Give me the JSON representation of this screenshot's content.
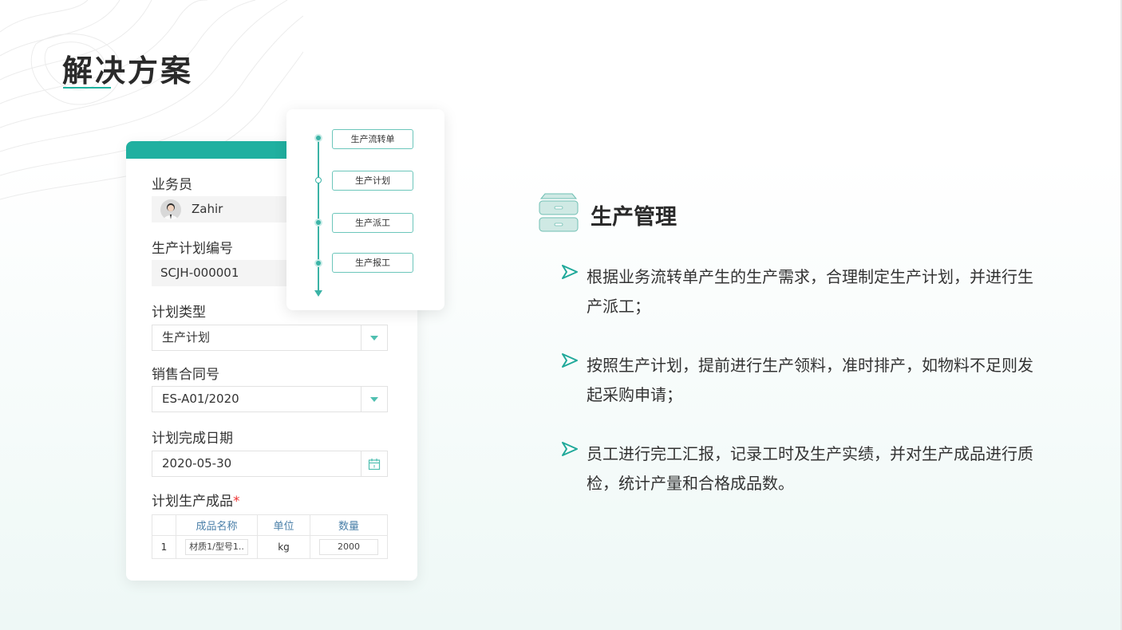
{
  "page": {
    "title": "解决方案"
  },
  "form": {
    "salesperson_label": "业务员",
    "salesperson_name": "Zahir",
    "plan_no_label": "生产计划编号",
    "plan_no_value": "SCJH-000001",
    "plan_type_label": "计划类型",
    "plan_type_value": "生产计划",
    "contract_label": "销售合同号",
    "contract_value": "ES-A01/2020",
    "finish_date_label": "计划完成日期",
    "finish_date_value": "2020-05-30",
    "products_label": "计划生产成品",
    "required_mark": "*",
    "table": {
      "headers": [
        "",
        "成品名称",
        "单位",
        "数量"
      ],
      "rows": [
        {
          "index": "1",
          "name": "材质1/型号1..",
          "unit": "kg",
          "qty": "2000"
        }
      ]
    }
  },
  "flow": {
    "steps": [
      "生产流转单",
      "生产计划",
      "生产派工",
      "生产报工"
    ]
  },
  "section": {
    "title": "生产管理",
    "bullets": [
      "根据业务流转单产生的生产需求，合理制定生产计划，并进行生产派工；",
      "按照生产计划，提前进行生产领料，准时排产，如物料不足则发起采购申请；",
      "员工进行完工汇报，记录工时及生产实绩，并对生产成品进行质检，统计产量和合格成品数。"
    ]
  },
  "colors": {
    "accent": "#20b0a0",
    "title": "#2a2a2a"
  },
  "icons": [
    "dropdown-caret-icon",
    "calendar-icon",
    "drawer-cabinet-icon",
    "arrow-bullet-icon"
  ]
}
